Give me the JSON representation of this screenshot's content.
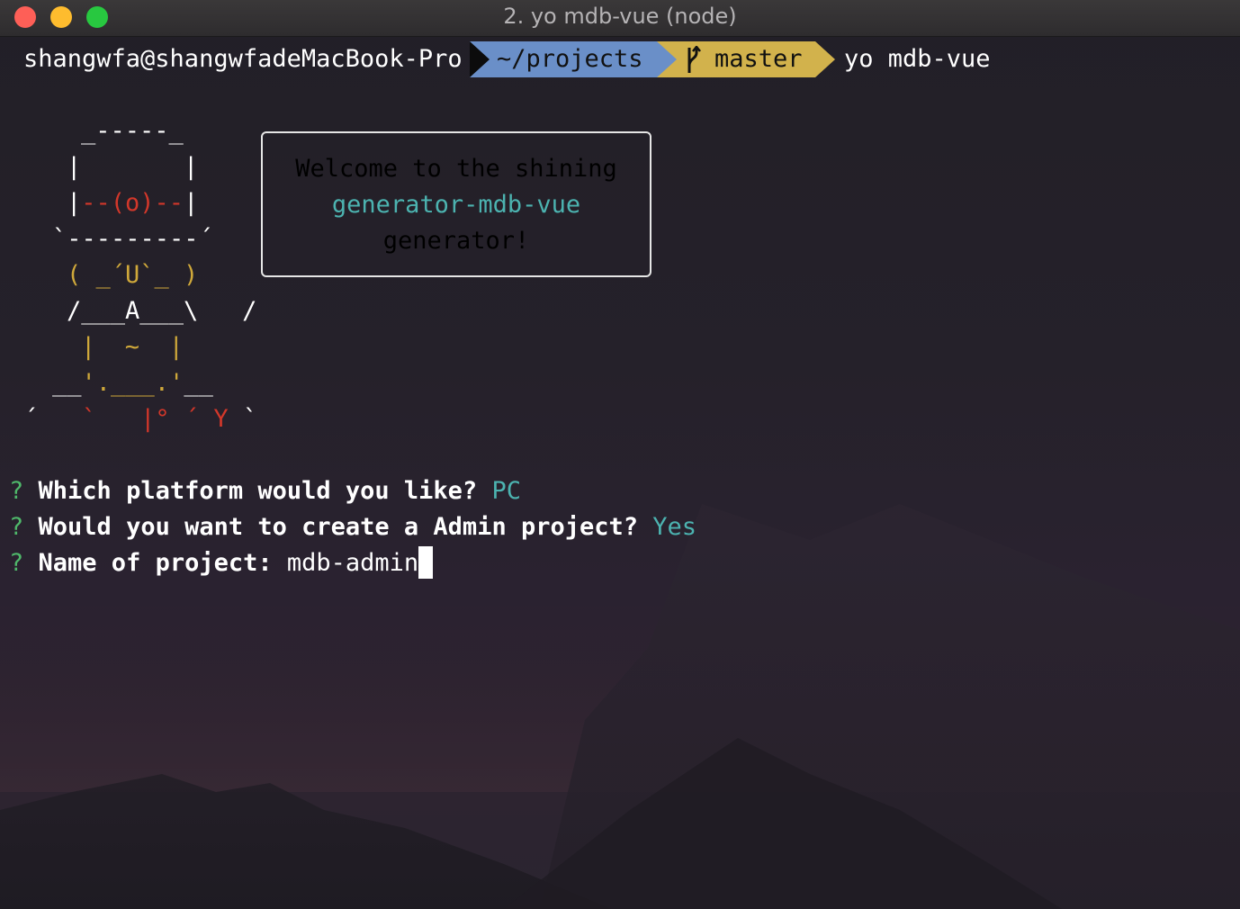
{
  "window": {
    "title": "2. yo mdb-vue (node)"
  },
  "prompt": {
    "user_host": "shangwfa@shangwfadeMacBook-Pro",
    "path": "~/projects",
    "branch": "master",
    "command": "yo mdb-vue"
  },
  "yeoman_art": {
    "line1": "_-----_",
    "line2": "|       |",
    "line3_a": "|",
    "line3_b": "--(o)--",
    "line3_c": "|",
    "line4": "`---------´",
    "line5": "( _´U`_ )",
    "line6_a": "/___A___\\",
    "line6_b": "/",
    "line7_a": "|",
    "line7_b": "~",
    "line7_c": "|",
    "line8_a": "__",
    "line8_b": "'.___.'",
    "line8_c": "__",
    "line9_a": "´",
    "line9_b": "`",
    "line9_c": "|°",
    "line9_d": "´",
    "line9_e": "Y",
    "line9_f": "`"
  },
  "welcome": {
    "line1": "Welcome to the shining",
    "line2": "generator-mdb-vue",
    "line3": "generator!"
  },
  "questions": [
    {
      "mark": "?",
      "text": "Which platform would you like?",
      "answer": "PC"
    },
    {
      "mark": "?",
      "text": "Would you want to create a Admin project?",
      "answer": "Yes"
    },
    {
      "mark": "?",
      "text": "Name of project:",
      "answer": "mdb-admin"
    }
  ],
  "colors": {
    "path_bg": "#6a8fc8",
    "branch_bg": "#d2b24c",
    "answer": "#4cb3b0",
    "question_mark": "#4fb86a",
    "accent_red": "#d2372a",
    "accent_yellow": "#cfa83a"
  }
}
